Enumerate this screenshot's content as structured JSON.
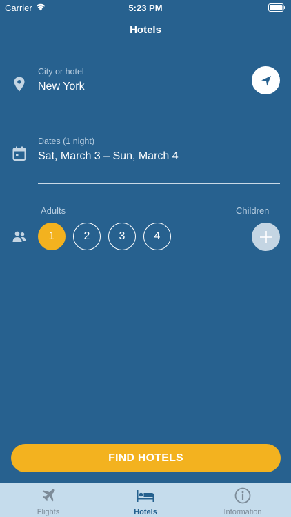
{
  "status_bar": {
    "carrier": "Carrier",
    "time": "5:23 PM"
  },
  "nav": {
    "title": "Hotels"
  },
  "city_field": {
    "label": "City or hotel",
    "value": "New York"
  },
  "dates_field": {
    "label": "Dates (1 night)",
    "value": "Sat, March 3 – Sun, March 4"
  },
  "guests": {
    "adults_label": "Adults",
    "children_label": "Children",
    "adult_options": [
      "1",
      "2",
      "3",
      "4"
    ],
    "selected_adults": "1"
  },
  "find_button": {
    "label": "FIND HOTELS"
  },
  "tabs": [
    {
      "label": "Flights",
      "icon": "airplane-icon"
    },
    {
      "label": "Hotels",
      "icon": "bed-icon"
    },
    {
      "label": "Information",
      "icon": "info-icon"
    }
  ],
  "colors": {
    "background": "#27618f",
    "accent": "#f3b21f",
    "tab_bar": "#c5dcec",
    "active_tab": "#24608e"
  }
}
